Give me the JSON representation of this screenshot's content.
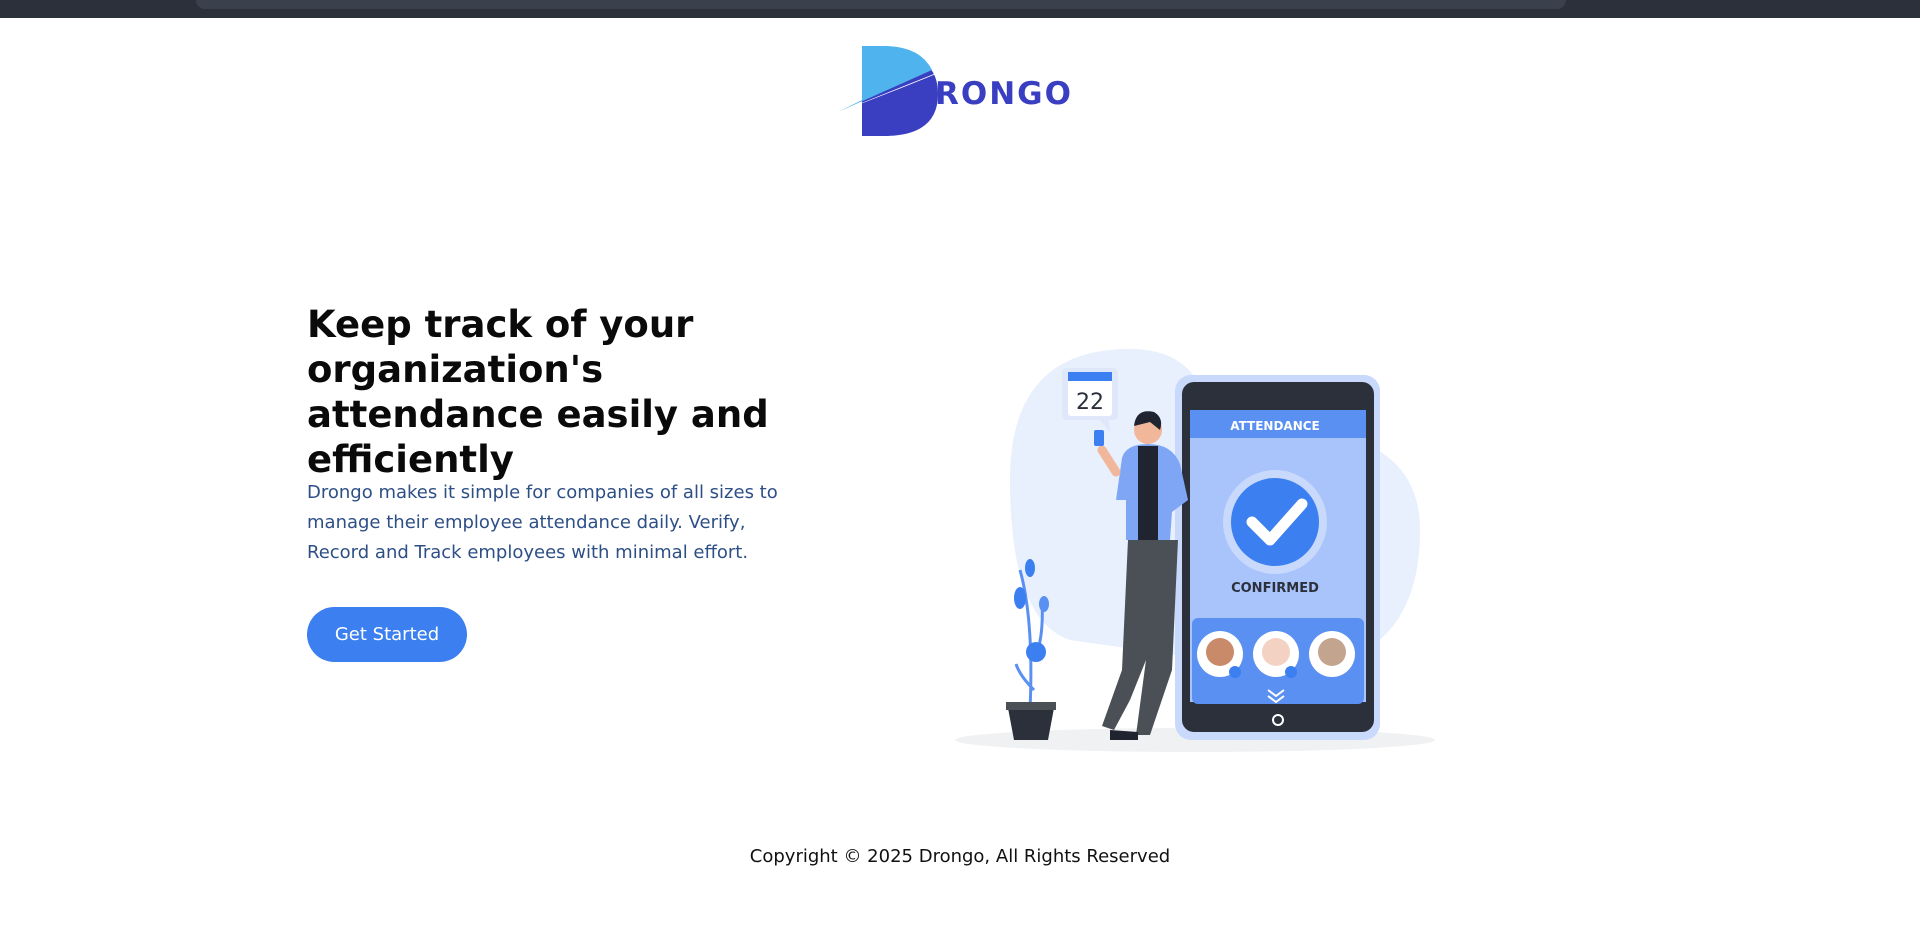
{
  "brand": {
    "name_suffix": "RONGO",
    "colors": {
      "logo_light": "#4fb3ee",
      "logo_dark": "#3a3fc2",
      "primary": "#3b7ff0",
      "text_dark": "#0a0a0a",
      "text_blue": "#2d4f86"
    }
  },
  "hero": {
    "title": "Keep track of your organization's attendance easily and efficiently",
    "description": "Drongo makes it simple for companies of all sizes to manage their employee attendance daily. Verify, Record and Track employees with minimal effort.",
    "cta_label": "Get Started"
  },
  "illustration": {
    "calendar_day": "22",
    "phone_header": "ATTENDANCE",
    "status": "CONFIRMED"
  },
  "footer": {
    "copyright": "Copyright © 2025 Drongo, All Rights Reserved"
  }
}
